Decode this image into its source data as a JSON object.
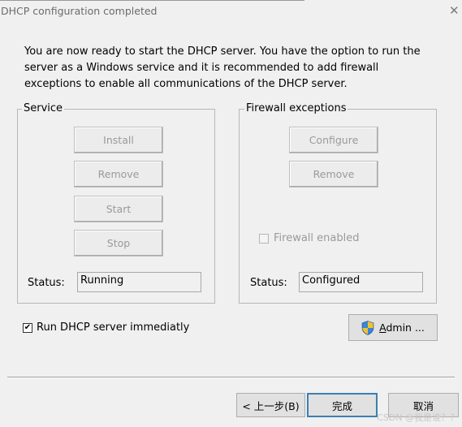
{
  "window": {
    "title": "DHCP configuration completed",
    "close_glyph": "✕"
  },
  "intro_text": "You are now ready to start the DHCP server. You have the option to run the server as a Windows service and it is recommended to add firewall exceptions to enable all communications of the DHCP server.",
  "service": {
    "legend": "Service",
    "install_label": "Install",
    "remove_label": "Remove",
    "start_label": "Start",
    "stop_label": "Stop",
    "status_label": "Status:",
    "status_value": "Running"
  },
  "firewall": {
    "legend": "Firewall exceptions",
    "configure_label": "Configure",
    "remove_label": "Remove",
    "enabled_label": "Firewall enabled",
    "enabled_checked": false,
    "status_label": "Status:",
    "status_value": "Configured"
  },
  "run_immediately": {
    "label": "Run DHCP server immediatly",
    "checked": true,
    "check_glyph": "✔"
  },
  "admin_button": {
    "label_underlined": "A",
    "label_rest": "dmin ...",
    "icon": "uac-shield-icon"
  },
  "footer": {
    "back_label": "< 上一步(B)",
    "finish_label": "完成",
    "cancel_label": "取消"
  },
  "watermark": "CSDN @我是谁？？"
}
